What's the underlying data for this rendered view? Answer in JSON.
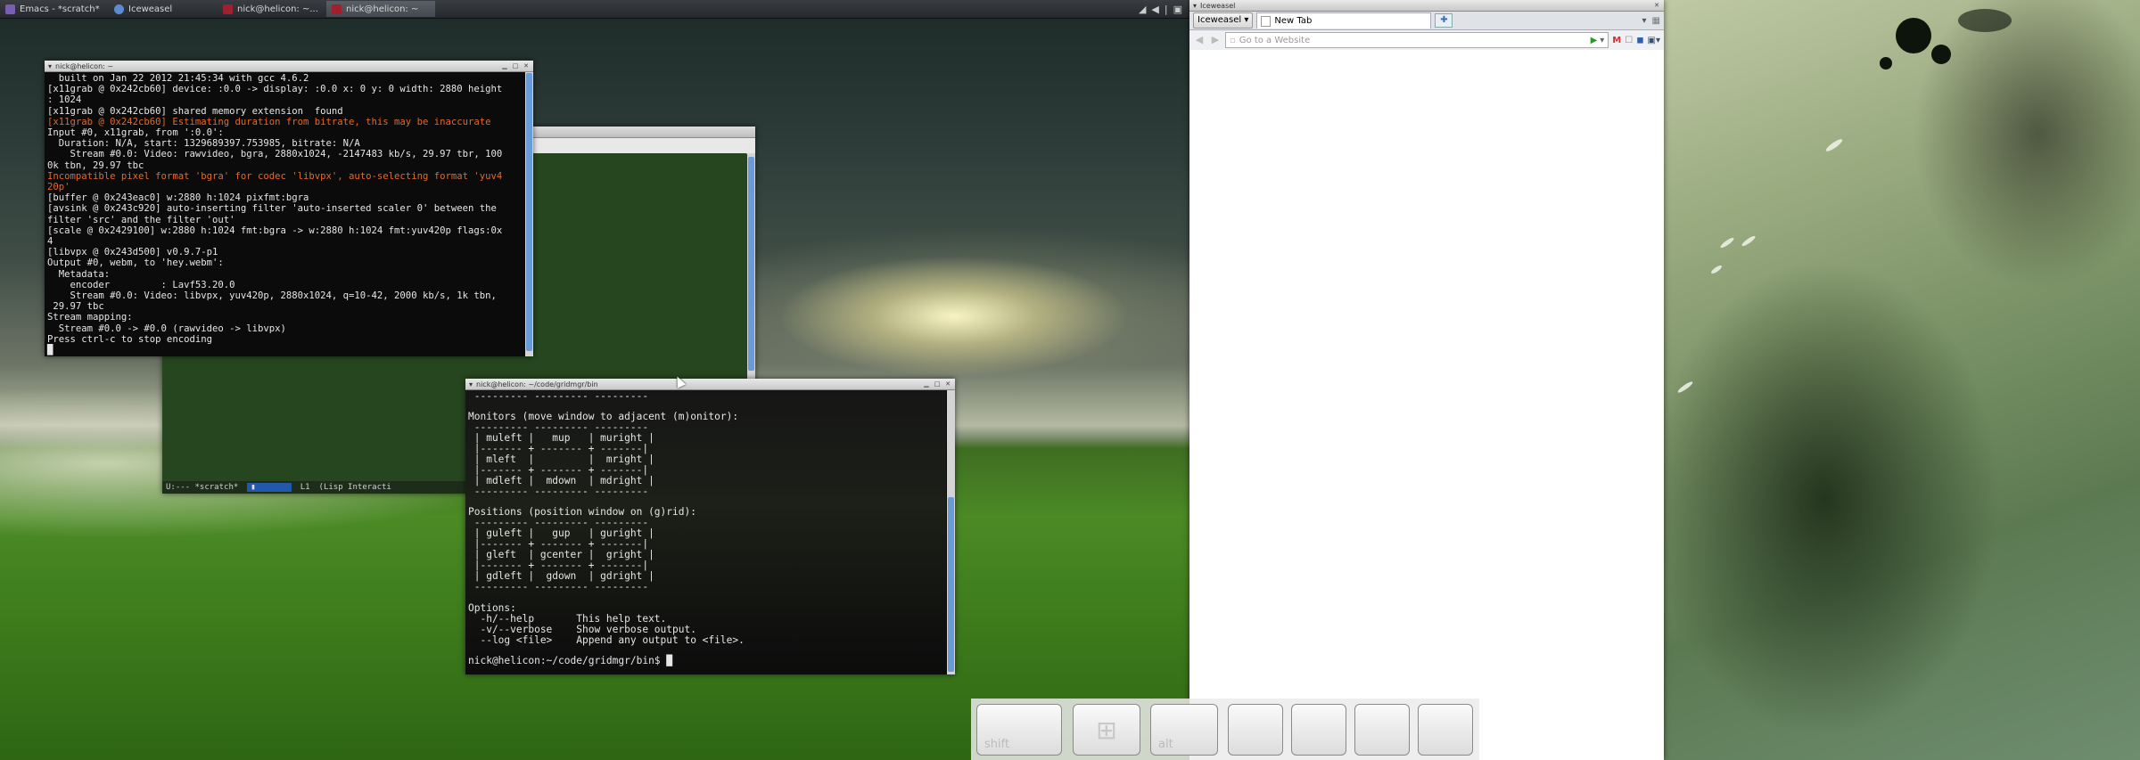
{
  "taskbar": {
    "tasks": [
      {
        "label": "Emacs - *scratch*"
      },
      {
        "label": "Iceweasel"
      },
      {
        "label": "nick@helicon: ~..."
      },
      {
        "label": "nick@helicon: ~"
      }
    ]
  },
  "emacs": {
    "modeline_buffer": "U:--- *scratch*",
    "modeline_position": "L1",
    "modeline_mode": "(Lisp Interacti"
  },
  "ffmpeg_term": {
    "title": "nick@helicon: ~",
    "lines": [
      {
        "text": "  built on Jan 22 2012 21:45:34 with gcc 4.6.2",
        "warn": false
      },
      {
        "text": "[x11grab @ 0x242cb60] device: :0.0 -> display: :0.0 x: 0 y: 0 width: 2880 height",
        "warn": false
      },
      {
        "text": ": 1024",
        "warn": false
      },
      {
        "text": "[x11grab @ 0x242cb60] shared memory extension  found",
        "warn": false
      },
      {
        "text": "[x11grab @ 0x242cb60] Estimating duration from bitrate, this may be inaccurate",
        "warn": true
      },
      {
        "text": "Input #0, x11grab, from ':0.0':",
        "warn": false
      },
      {
        "text": "  Duration: N/A, start: 1329689397.753985, bitrate: N/A",
        "warn": false
      },
      {
        "text": "    Stream #0.0: Video: rawvideo, bgra, 2880x1024, -2147483 kb/s, 29.97 tbr, 100",
        "warn": false
      },
      {
        "text": "0k tbn, 29.97 tbc",
        "warn": false
      },
      {
        "text": "Incompatible pixel format 'bgra' for codec 'libvpx', auto-selecting format 'yuv4",
        "warn": true
      },
      {
        "text": "20p'",
        "warn": true
      },
      {
        "text": "[buffer @ 0x243eac0] w:2880 h:1024 pixfmt:bgra",
        "warn": false
      },
      {
        "text": "[avsink @ 0x243c920] auto-inserting filter 'auto-inserted scaler 0' between the",
        "warn": false
      },
      {
        "text": "filter 'src' and the filter 'out'",
        "warn": false
      },
      {
        "text": "[scale @ 0x2429100] w:2880 h:1024 fmt:bgra -> w:2880 h:1024 fmt:yuv420p flags:0x",
        "warn": false
      },
      {
        "text": "4",
        "warn": false
      },
      {
        "text": "[libvpx @ 0x243d500] v0.9.7-p1",
        "warn": false
      },
      {
        "text": "Output #0, webm, to 'hey.webm':",
        "warn": false
      },
      {
        "text": "  Metadata:",
        "warn": false
      },
      {
        "text": "    encoder         : Lavf53.20.0",
        "warn": false
      },
      {
        "text": "    Stream #0.0: Video: libvpx, yuv420p, 2880x1024, q=10-42, 2000 kb/s, 1k tbn,",
        "warn": false
      },
      {
        "text": " 29.97 tbc",
        "warn": false
      },
      {
        "text": "Stream mapping:",
        "warn": false
      },
      {
        "text": "  Stream #0.0 -> #0.0 (rawvideo -> libvpx)",
        "warn": false
      },
      {
        "text": "Press ctrl-c to stop encoding",
        "warn": false
      },
      {
        "text": "█",
        "warn": false
      }
    ]
  },
  "gridmgr_term": {
    "title": "nick@helicon: ~/code/gridmgr/bin",
    "lines": [
      " --------- --------- ---------",
      "",
      "Monitors (move window to adjacent (m)onitor):",
      " --------- --------- ---------",
      " | muleft |   mup   | muright |",
      " |------- + ------- + -------|",
      " | mleft  |         |  mright |",
      " |------- + ------- + -------|",
      " | mdleft |  mdown  | mdright |",
      " --------- --------- ---------",
      "",
      "Positions (position window on (g)rid):",
      " --------- --------- ---------",
      " | guleft |   gup   | guright |",
      " |------- + ------- + -------|",
      " | gleft  | gcenter |  gright |",
      " |------- + ------- + -------|",
      " | gdleft |  gdown  | gdright |",
      " --------- --------- ---------",
      "",
      "Options:",
      "  -h/--help       This help text.",
      "  -v/--verbose    Show verbose output.",
      "  --log <file>    Append any output to <file>.",
      "",
      "nick@helicon:~/code/gridmgr/bin$ █"
    ]
  },
  "iceweasel": {
    "title": "Iceweasel",
    "menu_button": "Iceweasel",
    "tab_label": "New Tab",
    "url_placeholder": "Go to a Website"
  },
  "osk": {
    "keys": [
      {
        "label": "shift"
      },
      {
        "label": ""
      },
      {
        "label": "alt"
      },
      {
        "label": ""
      },
      {
        "label": ""
      },
      {
        "label": ""
      },
      {
        "label": ""
      }
    ]
  }
}
